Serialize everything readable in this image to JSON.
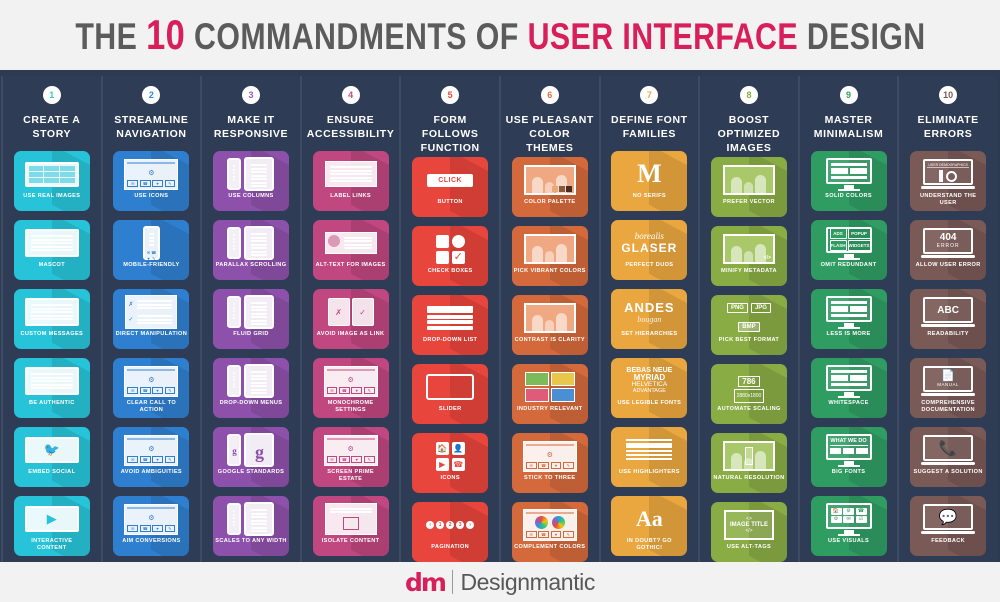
{
  "header": {
    "title_prefix": "THE",
    "number": "10",
    "title_mid": "COMMANDMENTS OF",
    "title_accent": "USER INTERFACE",
    "title_suffix": "DESIGN"
  },
  "footer": {
    "logo_mark": "dm",
    "logo_name": "Designmantic"
  },
  "columns": [
    {
      "number": "1",
      "badge_color": "#32c8d8",
      "title": "CREATE A STORY",
      "card_color": "#27c4d9",
      "cards": [
        {
          "label": "USE REAL IMAGES",
          "art": "tablet-photos"
        },
        {
          "label": "MASCOT",
          "art": "tablet-mascot"
        },
        {
          "label": "CUSTOM MESSAGES",
          "art": "tablet-message"
        },
        {
          "label": "BE AUTHENTIC",
          "art": "tablet-text"
        },
        {
          "label": "EMBED SOCIAL",
          "art": "tablet-twitter"
        },
        {
          "label": "INTERACTIVE CONTENT",
          "art": "tablet-video"
        }
      ]
    },
    {
      "number": "2",
      "badge_color": "#2f86d6",
      "title": "STREAMLINE NAVIGATION",
      "card_color": "#2f7fd0",
      "cards": [
        {
          "label": "USE ICONS",
          "art": "browser-icons"
        },
        {
          "label": "MOBILE-FRIENDLY",
          "art": "phone-icons"
        },
        {
          "label": "DIRECT MANIPULATION",
          "art": "checklist"
        },
        {
          "label": "CLEAR CALL TO ACTION",
          "art": "browser-cta"
        },
        {
          "label": "AVOID AMBIGUITIES",
          "art": "browser-arrow"
        },
        {
          "label": "AIM CONVERSIONS",
          "art": "browser-sale"
        }
      ]
    },
    {
      "number": "3",
      "badge_color": "#9b59b6",
      "title": "MAKE IT RESPONSIVE",
      "card_color": "#8e51ab",
      "cards": [
        {
          "label": "USE COLUMNS",
          "art": "phone-tablet"
        },
        {
          "label": "PARALLAX SCROLLING",
          "art": "phone-tablet"
        },
        {
          "label": "FLUID GRID",
          "art": "phone-tablet"
        },
        {
          "label": "DROP-DOWN MENUS",
          "art": "phone-tablet"
        },
        {
          "label": "GOOGLE STANDARDS",
          "art": "phone-tablet-g"
        },
        {
          "label": "SCALES TO ANY WIDTH",
          "art": "phone-tablet"
        }
      ]
    },
    {
      "number": "4",
      "badge_color": "#c94b86",
      "title": "ENSURE ACCESSIBILITY",
      "card_color": "#c0477f",
      "cards": [
        {
          "label": "LABEL LINKS",
          "art": "form"
        },
        {
          "label": "ALT-TEXT FOR IMAGES",
          "art": "profile"
        },
        {
          "label": "AVOID IMAGE AS LINK",
          "art": "two-panels"
        },
        {
          "label": "MONOCHROME SETTINGS",
          "art": "browser-icons"
        },
        {
          "label": "SCREEN PRIME ESTATE",
          "art": "browser-icons"
        },
        {
          "label": "ISOLATE CONTENT",
          "art": "isolate"
        }
      ]
    },
    {
      "number": "5",
      "badge_color": "#e8453c",
      "title": "FORM FOLLOWS FUNCTION",
      "card_color": "#e8453c",
      "cards": [
        {
          "label": "BUTTON",
          "art": "button",
          "art_text": "CLICK"
        },
        {
          "label": "CHECK BOXES",
          "art": "checkboxes"
        },
        {
          "label": "DROP-DOWN LIST",
          "art": "dropdown"
        },
        {
          "label": "SLIDER",
          "art": "slider"
        },
        {
          "label": "ICONS",
          "art": "four-icons"
        },
        {
          "label": "PAGINATION",
          "art": "pagination",
          "art_items": [
            "‹",
            "1",
            "2",
            "3",
            "›"
          ]
        }
      ]
    },
    {
      "number": "6",
      "badge_color": "#e2703a",
      "title": "USE PLEASANT COLOR THEMES",
      "card_color": "#d4693c",
      "cards": [
        {
          "label": "COLOR PALETTE",
          "art": "family-swatches"
        },
        {
          "label": "PICK VIBRANT COLORS",
          "art": "family-dull"
        },
        {
          "label": "CONTRAST IS CLARITY",
          "art": "family-bright"
        },
        {
          "label": "INDUSTRY RELEVANT",
          "art": "four-tiles"
        },
        {
          "label": "STICK TO THREE",
          "art": "browser-three"
        },
        {
          "label": "COMPLEMENT COLORS",
          "art": "color-wheels"
        }
      ]
    },
    {
      "number": "7",
      "badge_color": "#eda63a",
      "title": "DEFINE FONT FAMILIES",
      "card_color": "#eaa73f",
      "cards": [
        {
          "label": "NO SERIFS",
          "art": "letter",
          "art_text": "M"
        },
        {
          "label": "PERFECT DUOS",
          "art": "font-duo",
          "art_text": "borealis",
          "art_text2": "GLASER"
        },
        {
          "label": "SET HIERARCHIES",
          "art": "font-hierarchy",
          "art_text": "ANDES",
          "art_text2": "bougan"
        },
        {
          "label": "USE LEGIBLE FONTS",
          "art": "font-list",
          "art_items": [
            "BEBAS NEUE",
            "MYRIAD",
            "HELVETICA",
            "ADVANTAGE"
          ]
        },
        {
          "label": "USE HIGHLIGHTERS",
          "art": "highlight"
        },
        {
          "label": "IN DOUBT? GO GOTHIC!",
          "art": "letter",
          "art_text": "Aa"
        }
      ]
    },
    {
      "number": "8",
      "badge_color": "#8aab3c",
      "title": "BOOST OPTIMIZED IMAGES",
      "card_color": "#8aac44",
      "cards": [
        {
          "label": "PREFER VECTOR",
          "art": "family-photo"
        },
        {
          "label": "MINIFY METADATA",
          "art": "family-code"
        },
        {
          "label": "PICK BEST FORMAT",
          "art": "formats",
          "art_items": [
            "PNG",
            "JPG",
            "BMP"
          ]
        },
        {
          "label": "AUTOMATE SCALING",
          "art": "scaling",
          "art_text": "786",
          "art_text2": "2880x1800"
        },
        {
          "label": "NATURAL RESOLUTION",
          "art": "family-crop"
        },
        {
          "label": "USE ALT-TAGS",
          "art": "alt-tags",
          "art_text": "IMAGE TITLE"
        }
      ]
    },
    {
      "number": "9",
      "badge_color": "#2e9e63",
      "title": "MASTER MINIMALISM",
      "card_color": "#2f9c62",
      "cards": [
        {
          "label": "SOLID COLORS",
          "art": "monitor-bars"
        },
        {
          "label": "OMIT REDUNDANT",
          "art": "monitor-quad",
          "art_items": [
            "ADS",
            "POPUP",
            "FLASH",
            "WIDGETS"
          ]
        },
        {
          "label": "LESS IS MORE",
          "art": "monitor-less"
        },
        {
          "label": "WHITESPACE",
          "art": "monitor-space"
        },
        {
          "label": "BIG FONTS",
          "art": "monitor-bigfont",
          "art_text": "WHAT WE DO"
        },
        {
          "label": "USE VISUALS",
          "art": "monitor-grid"
        }
      ]
    },
    {
      "number": "10",
      "badge_color": "#7a5b55",
      "title": "ELIMINATE ERRORS",
      "card_color": "#7a5a56",
      "cards": [
        {
          "label": "UNDERSTAND THE USER",
          "art": "laptop-chart",
          "art_text": "USER DEMOGRAPHICS"
        },
        {
          "label": "ALLOW USER ERROR",
          "art": "laptop-404",
          "art_text": "404",
          "art_text2": "ERROR"
        },
        {
          "label": "READABILITY",
          "art": "laptop-abc",
          "art_text": "ABC"
        },
        {
          "label": "COMPREHENSIVE DOCUMENTATION",
          "art": "laptop-doc",
          "art_text": "MANUAL"
        },
        {
          "label": "SUGGEST A SOLUTION",
          "art": "laptop-support"
        },
        {
          "label": "FEEDBACK",
          "art": "laptop-chat"
        }
      ]
    }
  ]
}
